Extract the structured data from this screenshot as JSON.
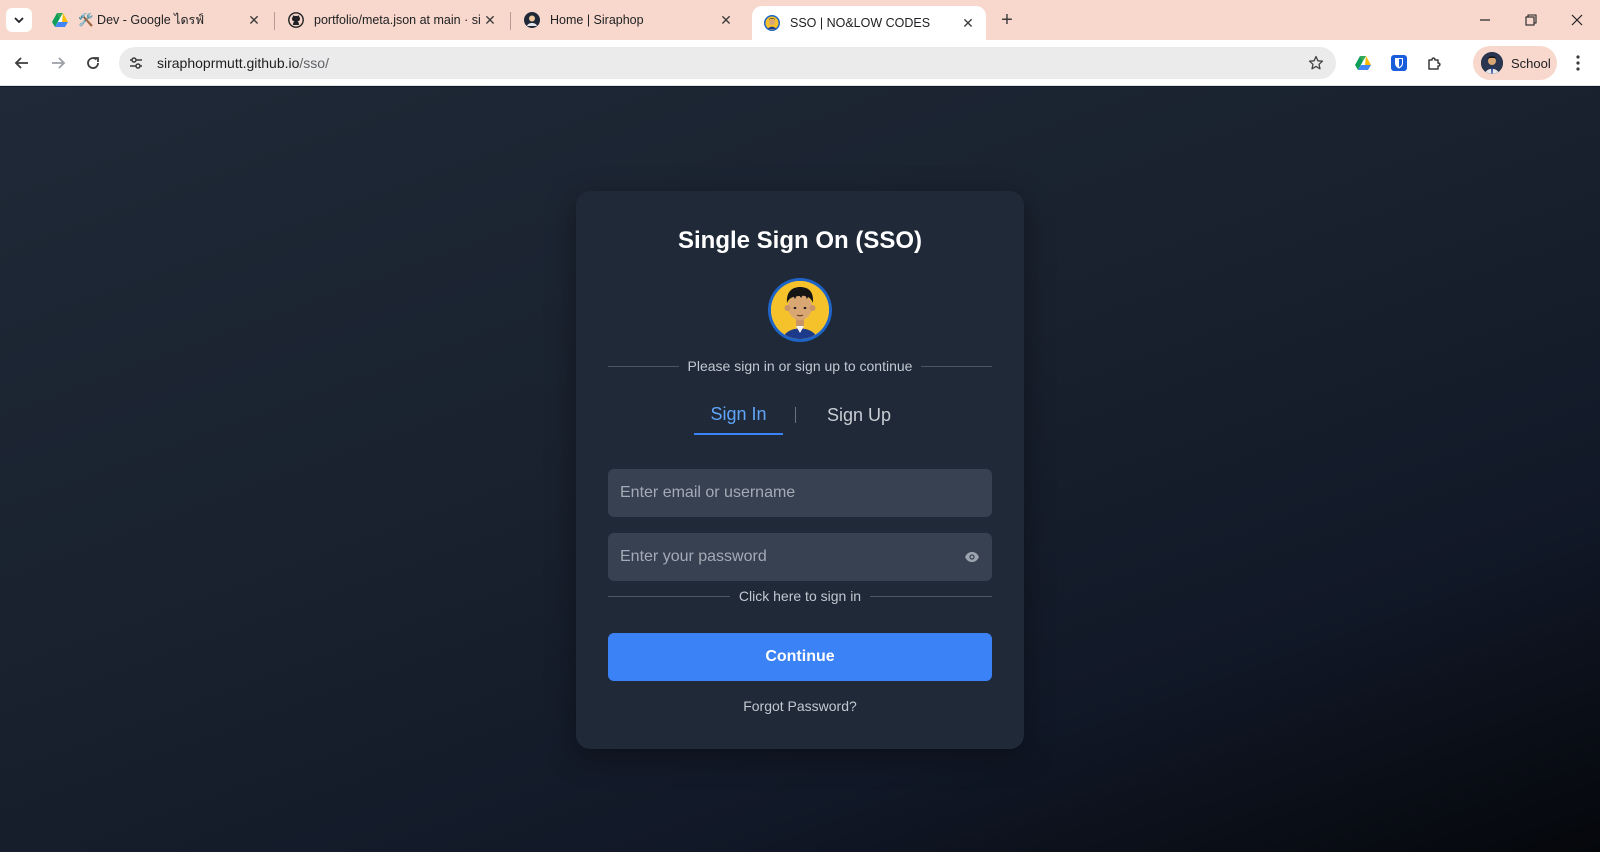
{
  "browser": {
    "tabs": [
      {
        "title": "🛠️ Dev - Google ไดรฟ์",
        "icon": "google-drive-icon",
        "active": false
      },
      {
        "title": "portfolio/meta.json at main · sir",
        "icon": "github-icon",
        "active": false
      },
      {
        "title": "Home | Siraphop",
        "icon": "site-logo-icon",
        "active": false
      },
      {
        "title": "SSO | NO&LOW CODES",
        "icon": "site-avatar-icon",
        "active": true
      }
    ],
    "url_host": "siraphoprmutt.github.io",
    "url_path": "/sso/",
    "profile_label": "School",
    "colors": {
      "tabstrip": "#f8d8cc",
      "toolbar": "#ffffff"
    }
  },
  "sso": {
    "title": "Single Sign On (SSO)",
    "subtitle": "Please sign in or sign up to continue",
    "tab_signin": "Sign In",
    "tab_signup": "Sign Up",
    "email_placeholder": "Enter email or username",
    "password_placeholder": "Enter your password",
    "hint": "Click here to sign in",
    "continue_label": "Continue",
    "forgot_label": "Forgot Password?",
    "colors": {
      "accent": "#3b82f6",
      "card": "#1f2937",
      "input": "#374151"
    }
  }
}
